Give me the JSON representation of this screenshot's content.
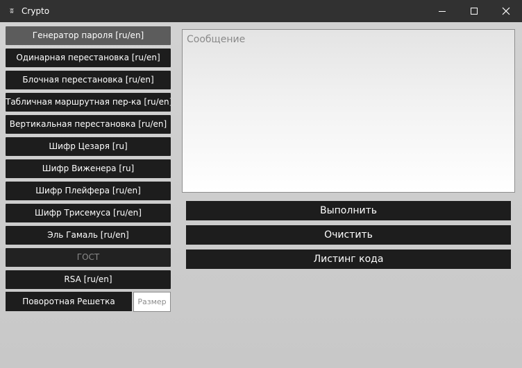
{
  "window": {
    "title": "Crypto",
    "icon": "kivy-icon",
    "controls": [
      "minimize-icon",
      "maximize-icon",
      "close-icon"
    ]
  },
  "sidebar": {
    "items": [
      {
        "label": "Генератор пароля [ru/en]",
        "state": "active"
      },
      {
        "label": "Одинарная перестановка [ru/en]",
        "state": "normal"
      },
      {
        "label": "Блочная перестановка [ru/en]",
        "state": "normal"
      },
      {
        "label": "Табличная маршрутная пер-ка [ru/en]",
        "state": "normal"
      },
      {
        "label": "Вертикальная перестановка [ru/en]",
        "state": "normal"
      },
      {
        "label": "Шифр Цезаря [ru]",
        "state": "normal"
      },
      {
        "label": "Шифр Виженера [ru]",
        "state": "normal"
      },
      {
        "label": "Шифр Плейфера [ru/en]",
        "state": "normal"
      },
      {
        "label": "Шифр Трисемуса [ru/en]",
        "state": "normal"
      },
      {
        "label": "Эль Гамаль [ru/en]",
        "state": "normal"
      },
      {
        "label": "ГОСТ",
        "state": "disabled"
      },
      {
        "label": "RSA [ru/en]",
        "state": "normal"
      }
    ],
    "rotating_grid": {
      "label": "Поворотная Решетка",
      "size_placeholder": "Размер"
    }
  },
  "main": {
    "message_placeholder": "Сообщение",
    "buttons": {
      "execute": "Выполнить",
      "clear": "Очистить",
      "listing": "Листинг кода"
    }
  },
  "colors": {
    "titlebar": "#313131",
    "button": "#1d1d1d",
    "active_button": "#5c5c5c",
    "background": "#cbcbcb"
  }
}
